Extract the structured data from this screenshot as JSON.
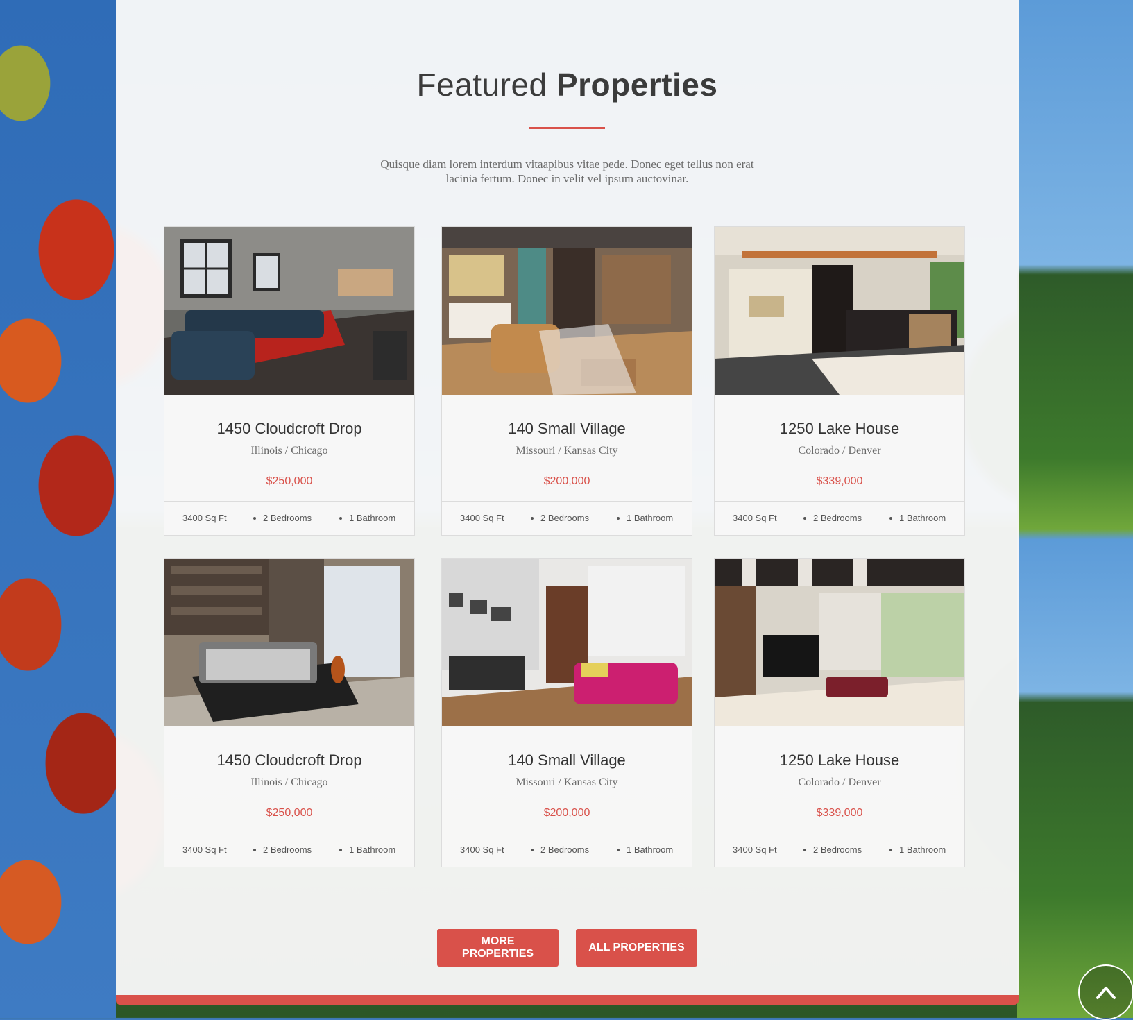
{
  "section": {
    "title_light": "Featured",
    "title_bold": "Properties",
    "intro": "Quisque diam lorem interdum vitaapibus vitae pede. Donec eget tellus non erat lacinia fertum. Donec in velit vel ipsum auctovinar."
  },
  "properties": [
    {
      "name": "1450 Cloudcroft Drop",
      "location": "Illinois / Chicago",
      "price": "$250,000",
      "area": "3400 Sq Ft",
      "bedrooms": "2 Bedrooms",
      "bathrooms": "1 Bathroom",
      "photo": "living-room-photo"
    },
    {
      "name": "140 Small Village",
      "location": "Missouri / Kansas City",
      "price": "$200,000",
      "area": "3400 Sq Ft",
      "bedrooms": "2 Bedrooms",
      "bathrooms": "1 Bathroom",
      "photo": "loft-interior-photo"
    },
    {
      "name": "1250 Lake House",
      "location": "Colorado / Denver",
      "price": "$339,000",
      "area": "3400 Sq Ft",
      "bedrooms": "2 Bedrooms",
      "bathrooms": "1 Bathroom",
      "photo": "kitchen-interior-photo"
    },
    {
      "name": "1450 Cloudcroft Drop",
      "location": "Illinois / Chicago",
      "price": "$250,000",
      "area": "3400 Sq Ft",
      "bedrooms": "2 Bedrooms",
      "bathrooms": "1 Bathroom",
      "photo": "bedroom-photo"
    },
    {
      "name": "140 Small Village",
      "location": "Missouri / Kansas City",
      "price": "$200,000",
      "area": "3400 Sq Ft",
      "bedrooms": "2 Bedrooms",
      "bathrooms": "1 Bathroom",
      "photo": "office-room-photo"
    },
    {
      "name": "1250 Lake House",
      "location": "Colorado / Denver",
      "price": "$339,000",
      "area": "3400 Sq Ft",
      "bedrooms": "2 Bedrooms",
      "bathrooms": "1 Bathroom",
      "photo": "lounge-photo"
    }
  ],
  "buttons": {
    "more": "MORE PROPERTIES",
    "all": "ALL PROPERTIES"
  },
  "colors": {
    "accent": "#d9514a"
  },
  "icons": {
    "back_to_top": "chevron-up-icon"
  }
}
